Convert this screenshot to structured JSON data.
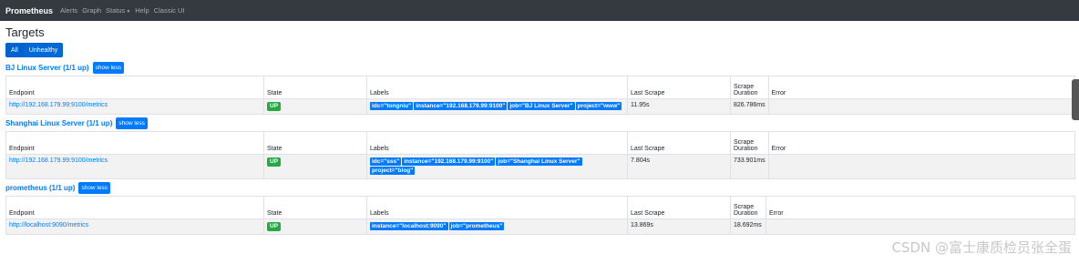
{
  "navbar": {
    "brand": "Prometheus",
    "links": [
      "Alerts",
      "Graph",
      "Status",
      "Help",
      "Classic UI"
    ]
  },
  "page": {
    "title": "Targets",
    "filter_all": "All",
    "filter_unhealthy": "Unhealthy",
    "show_less": "show less"
  },
  "columns": {
    "endpoint": "Endpoint",
    "state": "State",
    "labels": "Labels",
    "last_scrape": "Last Scrape",
    "scrape_duration": "Scrape Duration",
    "error": "Error"
  },
  "groups": [
    {
      "title": "BJ Linux Server (1/1 up)",
      "endpoint": "http://192.168.179.99:9100/metrics",
      "state": "UP",
      "labels": [
        "idc=\"tongniu\"",
        "instance=\"192.168.179.99:9100\"",
        "job=\"BJ Linux Server\"",
        "project=\"www\""
      ],
      "last_scrape": "11.95s",
      "scrape_duration": "826.786ms",
      "error": ""
    },
    {
      "title": "Shanghai Linux Server (1/1 up)",
      "endpoint": "http://192.168.179.99:9100/metrics",
      "state": "UP",
      "labels": [
        "idc=\"sss\"",
        "instance=\"192.168.179.99:9100\"",
        "job=\"Shanghai Linux Server\"",
        "project=\"blog\""
      ],
      "last_scrape": "7.804s",
      "scrape_duration": "733.901ms",
      "error": ""
    },
    {
      "title": "prometheus (1/1 up)",
      "endpoint": "http://localhost:9090/metrics",
      "state": "UP",
      "labels": [
        "instance=\"localhost:9090\"",
        "job=\"prometheus\""
      ],
      "last_scrape": "13.869s",
      "scrape_duration": "18.692ms",
      "error": ""
    }
  ],
  "watermark": "CSDN @富士康质检员张全蛋"
}
